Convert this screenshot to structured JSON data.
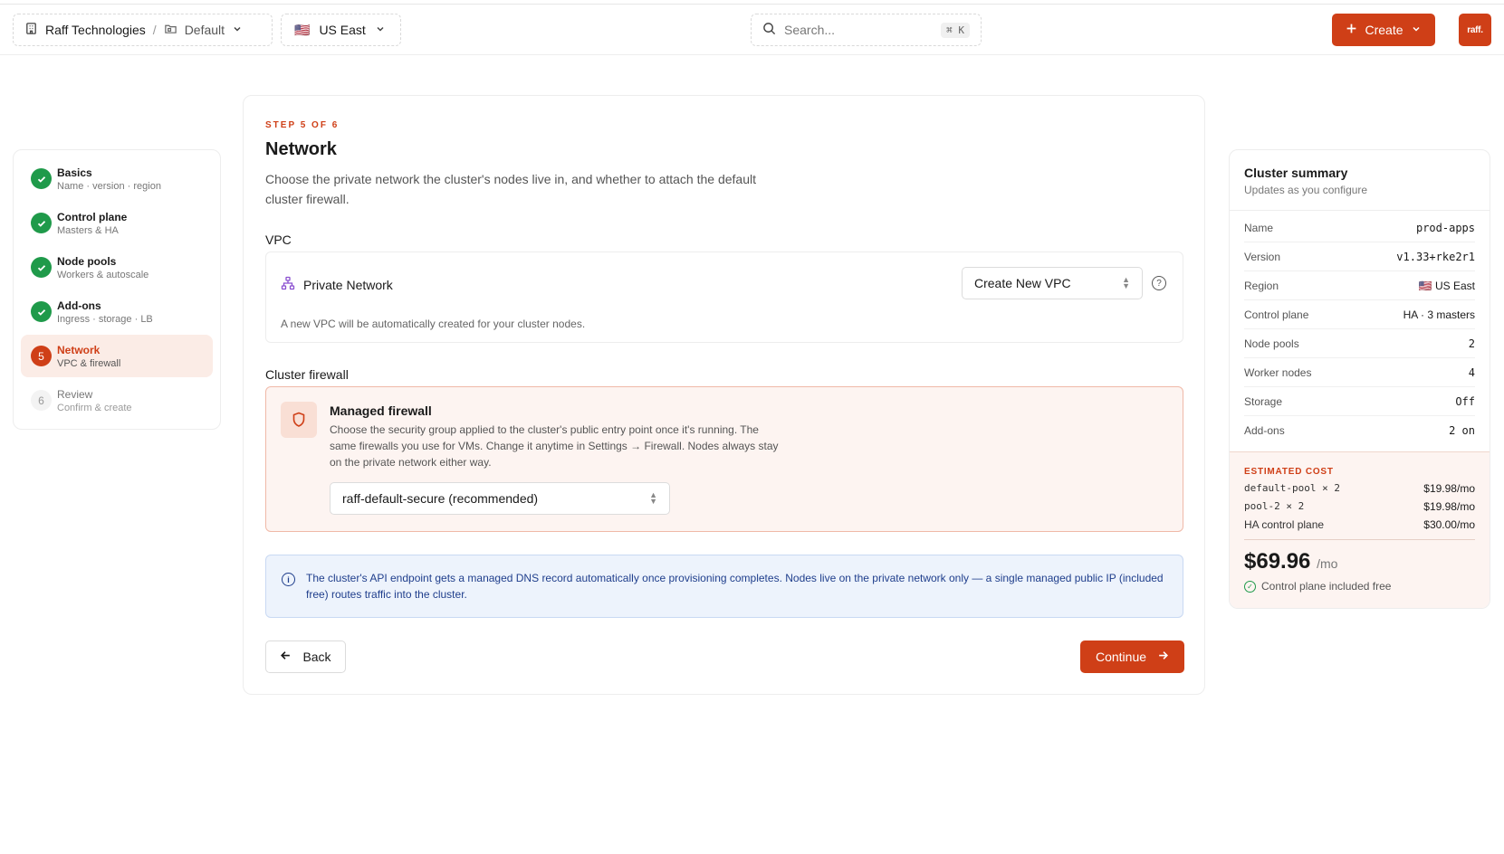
{
  "header": {
    "org": "Raff Technologies",
    "separator": "/",
    "project": "Default",
    "region_flag": "🇺🇸",
    "region": "US East",
    "search_placeholder": "Search...",
    "search_shortcut": "⌘ K",
    "create_label": "Create",
    "avatar_text": "raff."
  },
  "steps": [
    {
      "num": "1",
      "title": "Basics",
      "subtitle": "Name · version · region",
      "state": "done"
    },
    {
      "num": "2",
      "title": "Control plane",
      "subtitle": "Masters & HA",
      "state": "done"
    },
    {
      "num": "3",
      "title": "Node pools",
      "subtitle": "Workers & autoscale",
      "state": "done"
    },
    {
      "num": "4",
      "title": "Add-ons",
      "subtitle": "Ingress · storage · LB",
      "state": "done"
    },
    {
      "num": "5",
      "title": "Network",
      "subtitle": "VPC & firewall",
      "state": "active"
    },
    {
      "num": "6",
      "title": "Review",
      "subtitle": "Confirm & create",
      "state": "todo"
    }
  ],
  "main": {
    "eyebrow": "STEP 5 OF 6",
    "title": "Network",
    "description": "Choose the private network the cluster's nodes live in, and whether to attach the default cluster firewall.",
    "vpc_label": "VPC",
    "vpc_card_title": "Private Network",
    "vpc_select_value": "Create New VPC",
    "vpc_help": "?",
    "vpc_note": "A new VPC will be automatically created for your cluster nodes.",
    "firewall_label": "Cluster firewall",
    "firewall_title": "Managed firewall",
    "firewall_desc": "Choose the security group applied to the cluster's public entry point once it's running. The same firewalls you use for VMs. Change it anytime in Settings → Firewall. Nodes always stay on the private network either way.",
    "firewall_select_value": "raff-default-secure (recommended)",
    "info_icon": "i",
    "info_text": "The cluster's API endpoint gets a managed DNS record automatically once provisioning completes. Nodes live on the private network only — a single managed public IP (included free) routes traffic into the cluster.",
    "back_label": "Back",
    "continue_label": "Continue"
  },
  "summary": {
    "title": "Cluster summary",
    "subtitle": "Updates as you configure",
    "rows": [
      {
        "key": "Name",
        "value": "prod-apps",
        "mono": true
      },
      {
        "key": "Version",
        "value": "v1.33+rke2r1",
        "mono": true
      },
      {
        "key": "Region",
        "value": "🇺🇸 US East",
        "mono": false
      },
      {
        "key": "Control plane",
        "value": "HA · 3 masters",
        "mono": false
      },
      {
        "key": "Node pools",
        "value": "2",
        "mono": true
      },
      {
        "key": "Worker nodes",
        "value": "4",
        "mono": true
      },
      {
        "key": "Storage",
        "value": "Off",
        "mono": true
      },
      {
        "key": "Add-ons",
        "value": "2 on",
        "mono": true
      }
    ],
    "cost_label": "ESTIMATED COST",
    "cost_lines": [
      {
        "name": "default-pool × 2",
        "price": "$19.98/mo",
        "mono": true
      },
      {
        "name": "pool-2 × 2",
        "price": "$19.98/mo",
        "mono": true
      },
      {
        "name": "HA control plane",
        "price": "$30.00/mo",
        "mono": false
      }
    ],
    "total": "$69.96",
    "total_unit": "/mo",
    "free_note": "Control plane included free"
  },
  "colors": {
    "accent": "#cf3f17",
    "success": "#1f9a4a",
    "info": "#1f3e8c"
  }
}
